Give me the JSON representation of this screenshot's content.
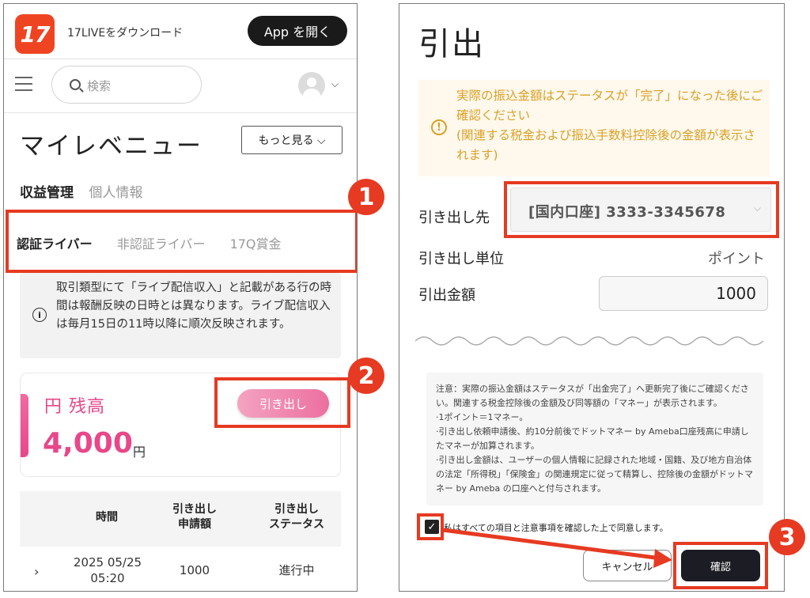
{
  "left": {
    "app_download": "17LIVEをダウンロード",
    "logo_text": "17",
    "app_open_button": "App を開く",
    "search_placeholder": "検索",
    "page_title": "マイレベニュー",
    "more_button": "もっと見る ⌵",
    "main_tabs": [
      {
        "label": "収益管理",
        "active": true
      },
      {
        "label": "個人情報",
        "active": false
      }
    ],
    "sub_tabs": [
      {
        "label": "認証ライバー",
        "active": true
      },
      {
        "label": "非認証ライバー",
        "active": false
      },
      {
        "label": "17Q賞金",
        "active": false
      }
    ],
    "info_text": "取引類型にて「ライブ配信収入」と記載がある行の時間は報酬反映の日時とは異なります。ライブ配信収入は毎月15日の11時以降に順次反映されます。",
    "balance_label": "円 残高",
    "balance_amount": "4,000",
    "balance_unit": "円",
    "withdraw_button": "引き出し",
    "table_headers": {
      "time": "時間",
      "amount_l1": "引き出し",
      "amount_l2": "申請額",
      "status_l1": "引き出し",
      "status_l2": "ステータス"
    },
    "rows": [
      {
        "date": "2025 05/25",
        "time": "05:20",
        "amount": "1000",
        "status": "進行中"
      }
    ]
  },
  "right": {
    "title": "引出",
    "warning_text": "実際の振込金額はステータスが「完了」になった後にご確認ください\n(関連する税金および振込手数料控除後の金額が表示されます)",
    "dest_label": "引き出し先",
    "dest_value": "[国内口座] 3333-3345678",
    "unit_label": "引き出し単位",
    "unit_value": "ポイント",
    "amount_label": "引出金額",
    "amount_value": "1000",
    "notes": [
      "注意：実際の振込金額はステータスが「出金完了」へ更新完了後にご確認ください。関連する税金控除後の金額及び同等額の「マネー」が表示されます。",
      "·1ポイント＝1マネー。",
      "·引き出し依頼申請後、約10分前後でドットマネー by Ameba口座残高に申請したマネーが加算されます。",
      "·引き出し金額は、ユーザーの個人情報に記録された地域・国籍、及び地方自治体の法定「所得税」「保険金」の関連規定に従って精算し、控除後の金額がドットマネー by Ameba の口座へと付与されます。"
    ],
    "agree_text": "私はすべての項目と注意事項を確認した上で同意します。",
    "cancel_button": "キャンセル",
    "confirm_button": "確認",
    "agree_checked": true
  },
  "steps": [
    "1",
    "2",
    "3"
  ],
  "colors": {
    "highlight_red": "#e63a22",
    "brand_pink": "#e8478a",
    "warning_orange": "#d9a128",
    "logo_red": "#ef4422"
  }
}
